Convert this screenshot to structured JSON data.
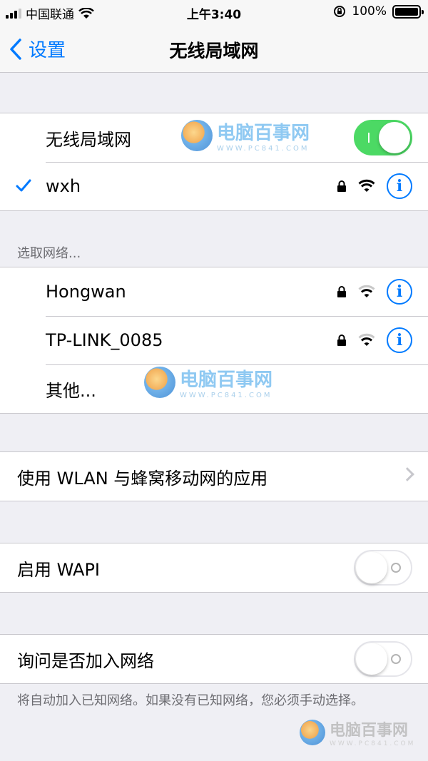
{
  "status_bar": {
    "carrier": "中国联通",
    "time": "上午3:40",
    "battery": "100%"
  },
  "nav": {
    "back_label": "设置",
    "title": "无线局域网"
  },
  "wifi_toggle": {
    "label": "无线局域网",
    "state": "on"
  },
  "connected": {
    "name": "wxh"
  },
  "choose_network": {
    "header": "选取网络...",
    "networks": [
      {
        "name": "Hongwan"
      },
      {
        "name": "TP-LINK_0085"
      }
    ],
    "other_label": "其他..."
  },
  "apps_row": {
    "label": "使用 WLAN 与蜂窝移动网的应用"
  },
  "wapi_row": {
    "label": "启用 WAPI",
    "state": "off"
  },
  "ask_row": {
    "label": "询问是否加入网络",
    "state": "off"
  },
  "footer": {
    "text": "将自动加入已知网络。如果没有已知网络，您必须手动选择。"
  },
  "watermark": {
    "main": "电脑百事网",
    "sub": "WWW.PC841.COM"
  },
  "colors": {
    "accent": "#007aff",
    "toggle_on": "#4cd964",
    "background": "#efeff4"
  }
}
